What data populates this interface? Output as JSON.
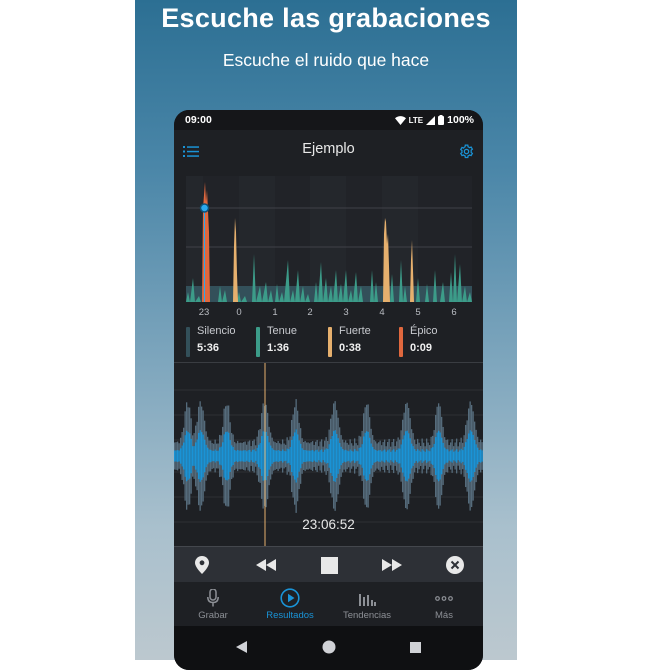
{
  "promo": {
    "headline": "Escuche las grabaciones",
    "subheadline": "Escuche el ruido que hace"
  },
  "status_bar": {
    "time": "09:00",
    "network": "LTE",
    "battery": "100%"
  },
  "app_bar": {
    "title": "Ejemplo",
    "left_icon": "list-icon",
    "right_icon": "gear-icon"
  },
  "chart_data": {
    "type": "area",
    "x_ticks": [
      "23",
      "0",
      "1",
      "2",
      "3",
      "4",
      "5",
      "6"
    ],
    "series": [
      {
        "name": "Silencio",
        "color": "#33505a"
      },
      {
        "name": "Tenue",
        "color": "#3c9c89"
      },
      {
        "name": "Fuerte",
        "color": "#e6b06e"
      },
      {
        "name": "Épico",
        "color": "#e0683e"
      }
    ],
    "highlight_marker": "x=23 peak",
    "grid": true
  },
  "legend": [
    {
      "label": "Silencio",
      "value": "5:36",
      "color": "#33505a"
    },
    {
      "label": "Tenue",
      "value": "1:36",
      "color": "#3c9c89"
    },
    {
      "label": "Fuerte",
      "value": "0:38",
      "color": "#e6b06e"
    },
    {
      "label": "Épico",
      "value": "0:09",
      "color": "#e0683e"
    }
  ],
  "player": {
    "timestamp": "23:06:52",
    "buttons": [
      "location-pin-icon",
      "rewind-icon",
      "stop-icon",
      "fast-forward-icon",
      "close-circle-icon"
    ]
  },
  "bottom_nav": [
    {
      "label": "Grabar",
      "icon": "microphone-icon",
      "active": false
    },
    {
      "label": "Resultados",
      "icon": "play-circle-icon",
      "active": true
    },
    {
      "label": "Tendencias",
      "icon": "bar-chart-icon",
      "active": false
    },
    {
      "label": "Más",
      "icon": "more-dots-icon",
      "active": false
    }
  ],
  "colors": {
    "accent": "#1a93d6",
    "wave": "#1a93d6",
    "background": "#1e2024"
  }
}
